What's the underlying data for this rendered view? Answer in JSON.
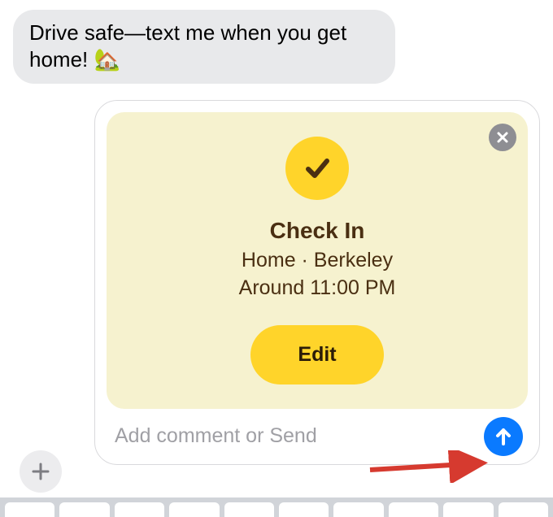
{
  "incoming_message": "Drive safe—text me when you get home! 🏡",
  "checkin": {
    "title": "Check In",
    "location_line": "Home · Berkeley",
    "time_line": "Around 11:00 PM",
    "edit_label": "Edit"
  },
  "compose": {
    "placeholder": "Add comment or Send"
  },
  "colors": {
    "accent_yellow": "#ffd42a",
    "card_bg": "#f6f2cf",
    "send_blue": "#0a7aff",
    "bubble_gray": "#e8e9eb",
    "annotation_red": "#d63a2f"
  }
}
